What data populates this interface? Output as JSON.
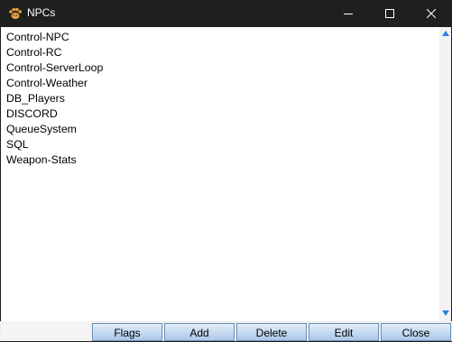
{
  "window": {
    "title": "NPCs"
  },
  "npc_list": [
    "Control-NPC",
    "Control-RC",
    "Control-ServerLoop",
    "Control-Weather",
    "DB_Players",
    "DISCORD",
    "QueueSystem",
    "SQL",
    "Weapon-Stats"
  ],
  "buttons": {
    "flags": "Flags",
    "add": "Add",
    "delete": "Delete",
    "edit": "Edit",
    "close": "Close"
  },
  "colors": {
    "titlebar": "#1f1f1f",
    "scroll_arrow": "#2a7fe0",
    "button_top": "#e3eef9",
    "button_bottom": "#aac7e8"
  },
  "icons": {
    "app": "pawprint-icon",
    "minimize": "minimize-icon",
    "maximize": "maximize-icon",
    "close": "close-icon"
  }
}
